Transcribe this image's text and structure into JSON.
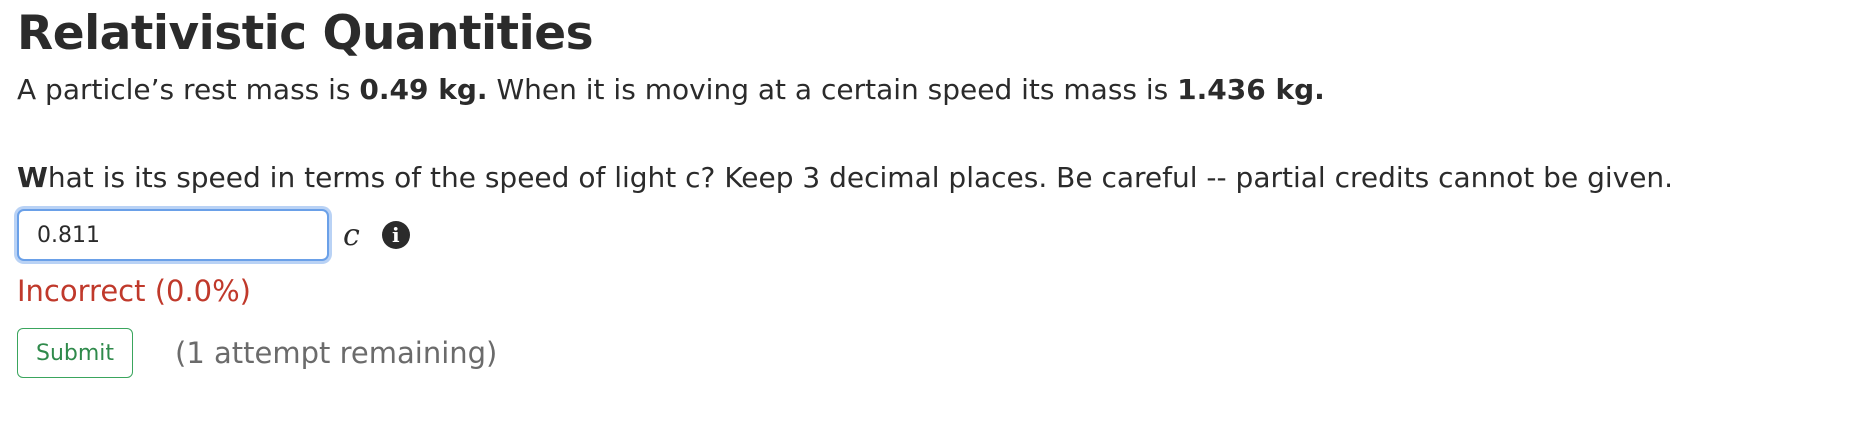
{
  "problem": {
    "title": "Relativistic Quantities",
    "statement": {
      "part1": "A particle’s rest mass is ",
      "rest_mass": "0.49 kg.",
      "part2": " When it is moving at a certain speed its mass is ",
      "moving_mass": "1.436 kg."
    },
    "question": {
      "first_letter": "W",
      "rest": "hat is its speed in terms of the speed of light c? Keep 3 decimal places. Be careful -- partial credits cannot be given."
    },
    "answer": {
      "value": "0.811",
      "unit": "c",
      "info_icon": "info-circle-icon",
      "info_glyph": "i"
    },
    "feedback": "Incorrect (0.0%)",
    "submit_label": "Submit",
    "attempts_text": "(1 attempt remaining)"
  },
  "colors": {
    "text": "#2b2b2b",
    "incorrect": "#c0392b",
    "submit_green": "#3aa55d",
    "input_focus_border": "#6aa0e8",
    "muted": "#6b6b6b"
  }
}
